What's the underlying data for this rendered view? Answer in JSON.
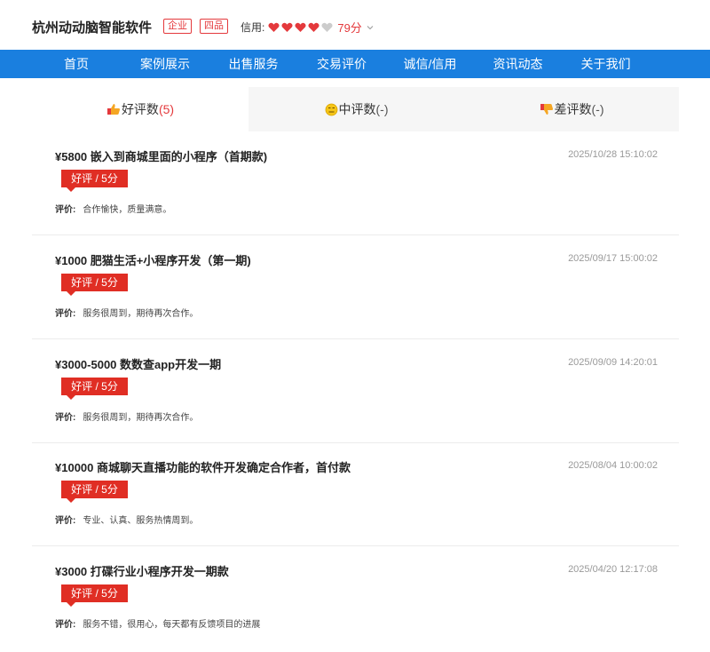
{
  "header": {
    "company": "杭州动动脑智能软件",
    "badge_enterprise": "企业",
    "badge_level": "四品",
    "credit_label": "信用:",
    "credit_score": "79分",
    "hearts_filled": 4,
    "hearts_total": 5,
    "heart_color": "#e4393c",
    "heart_empty_color": "#cccccc"
  },
  "nav": {
    "items": [
      "首页",
      "案例展示",
      "出售服务",
      "交易评价",
      "诚信/信用",
      "资讯动态",
      "关于我们"
    ],
    "active_index": 3,
    "bg": "#1a7fdf",
    "active_bg": "#0d5fb3"
  },
  "tabs": [
    {
      "icon": "thumbs-up-icon",
      "label": "好评数",
      "count": "(5)"
    },
    {
      "icon": "neutral-face-icon",
      "label": "中评数",
      "count": "(-)"
    },
    {
      "icon": "thumbs-down-icon",
      "label": "差评数",
      "count": "(-)"
    }
  ],
  "reviews": [
    {
      "title": "¥5800 嵌入到商城里面的小程序（首期款)",
      "date": "2025/10/28 15:10:02",
      "tag": "好评 / 5分",
      "comment_label": "评价:",
      "comment": "合作愉快，质量满意。"
    },
    {
      "title": "¥1000 肥猫生活+小程序开发（第一期)",
      "date": "2025/09/17 15:00:02",
      "tag": "好评 / 5分",
      "comment_label": "评价:",
      "comment": "服务很周到，期待再次合作。"
    },
    {
      "title": "¥3000-5000 数数查app开发一期",
      "date": "2025/09/09 14:20:01",
      "tag": "好评 / 5分",
      "comment_label": "评价:",
      "comment": "服务很周到，期待再次合作。"
    },
    {
      "title": "¥10000 商城聊天直播功能的软件开发确定合作者，首付款",
      "date": "2025/08/04 10:00:02",
      "tag": "好评 / 5分",
      "comment_label": "评价:",
      "comment": "专业、认真、服务热情周到。"
    },
    {
      "title": "¥3000 打碟行业小程序开发一期款",
      "date": "2025/04/20 12:17:08",
      "tag": "好评 / 5分",
      "comment_label": "评价:",
      "comment": "服务不错，很用心，每天都有反馈项目的进展"
    }
  ]
}
